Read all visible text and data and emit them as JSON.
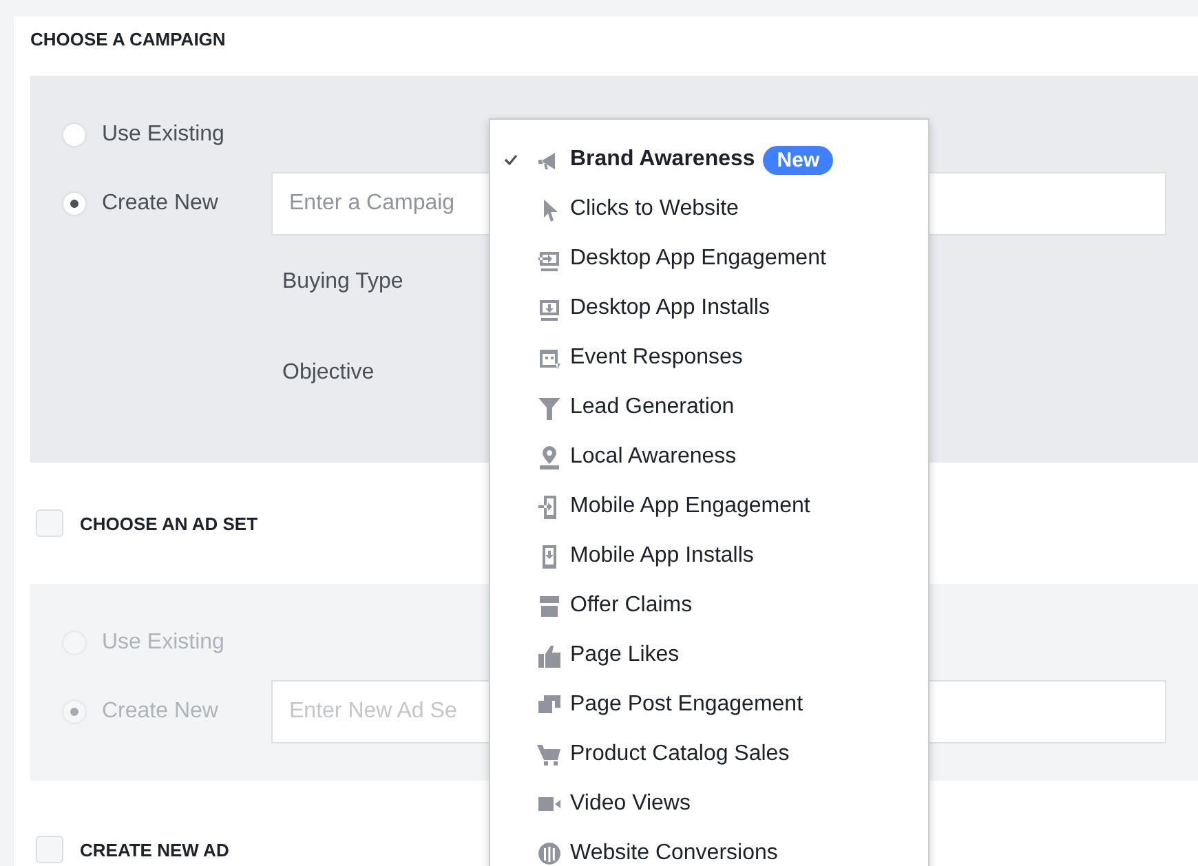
{
  "campaign": {
    "title": "CHOOSE A CAMPAIGN",
    "options": [
      {
        "label": "Use Existing",
        "selected": false
      },
      {
        "label": "Create New",
        "selected": true
      }
    ],
    "name_field": {
      "placeholder": "Enter a Campaig"
    },
    "fields": [
      {
        "label": "Buying Type"
      },
      {
        "label": "Objective"
      }
    ]
  },
  "ad_set": {
    "title": "CHOOSE AN AD SET",
    "checked": false,
    "disabled": true,
    "options": [
      {
        "label": "Use Existing",
        "selected": false
      },
      {
        "label": "Create New",
        "selected": true
      }
    ],
    "name_field": {
      "placeholder": "Enter New Ad Se"
    }
  },
  "new_ad": {
    "title": "CREATE NEW AD",
    "checked": false
  },
  "objective_menu": {
    "items": [
      {
        "label": "Brand Awareness",
        "selected": true,
        "badge": "New"
      },
      {
        "label": "Clicks to Website",
        "selected": false
      },
      {
        "label": "Desktop App Engagement",
        "selected": false
      },
      {
        "label": "Desktop App Installs",
        "selected": false
      },
      {
        "label": "Event Responses",
        "selected": false
      },
      {
        "label": "Lead Generation",
        "selected": false
      },
      {
        "label": "Local Awareness",
        "selected": false
      },
      {
        "label": "Mobile App Engagement",
        "selected": false
      },
      {
        "label": "Mobile App Installs",
        "selected": false
      },
      {
        "label": "Offer Claims",
        "selected": false
      },
      {
        "label": "Page Likes",
        "selected": false
      },
      {
        "label": "Page Post Engagement",
        "selected": false
      },
      {
        "label": "Product Catalog Sales",
        "selected": false
      },
      {
        "label": "Video Views",
        "selected": false
      },
      {
        "label": "Website Conversions",
        "selected": false
      }
    ]
  }
}
